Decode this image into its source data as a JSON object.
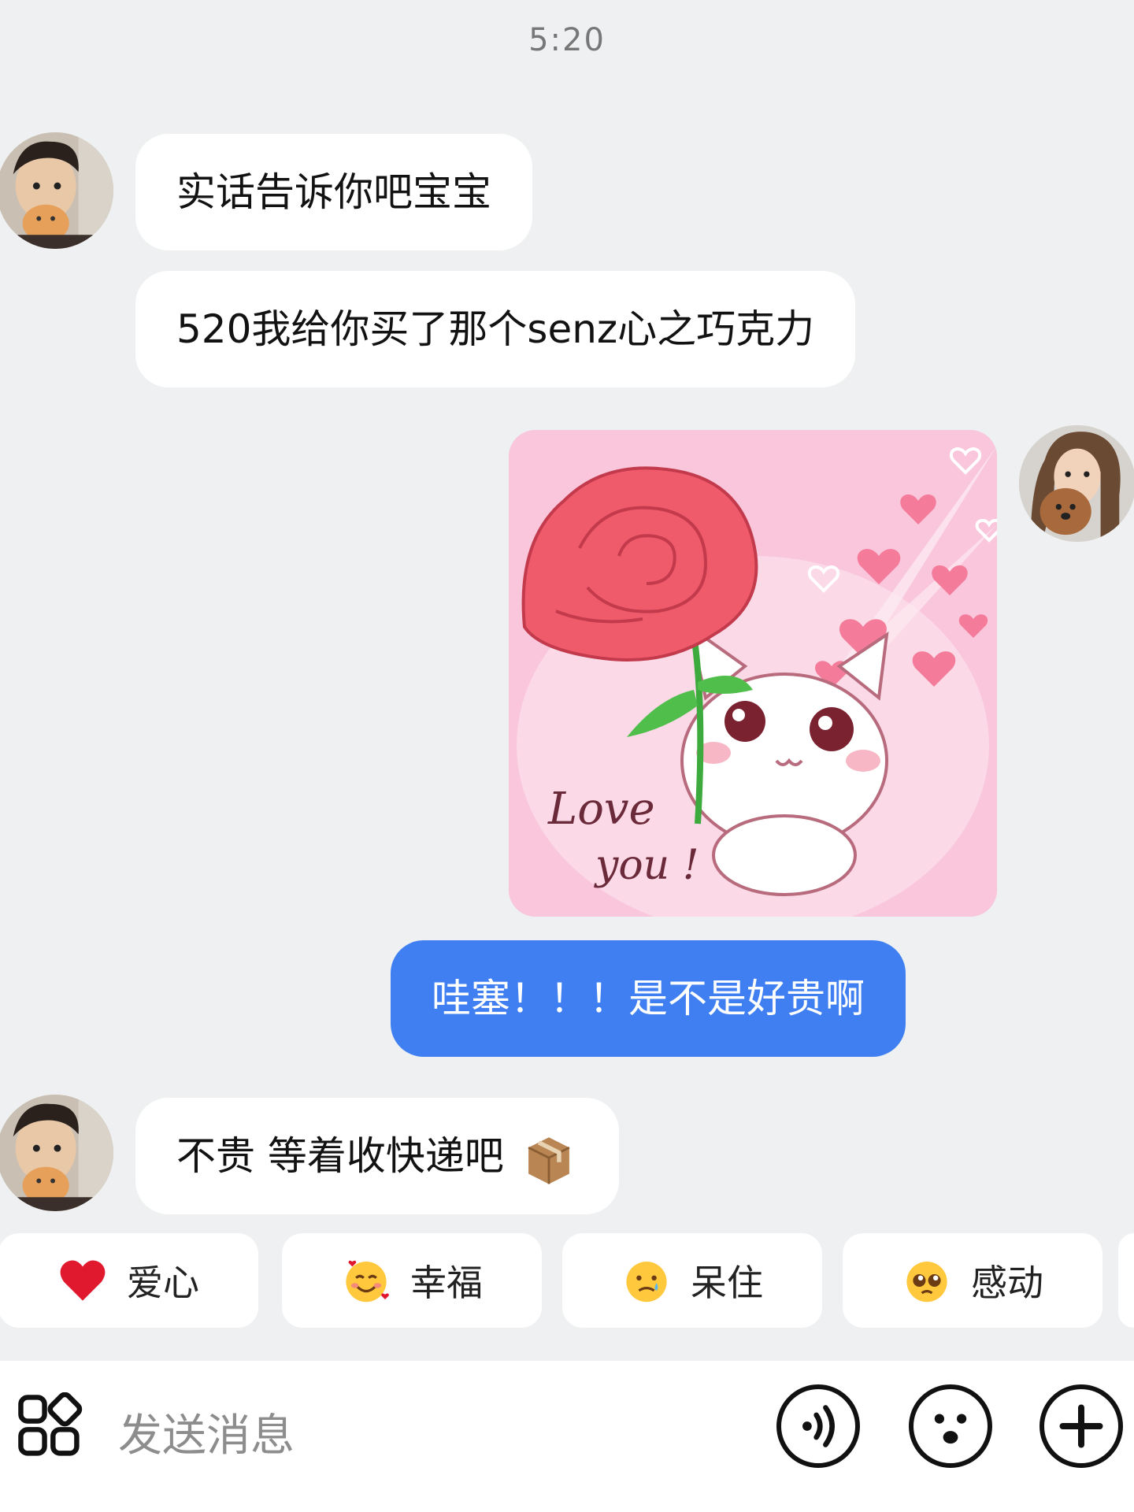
{
  "status": {
    "time": "5:20"
  },
  "messages": [
    {
      "from": "other",
      "text": "实话告诉你吧宝宝"
    },
    {
      "from": "other",
      "text": "520我给你买了那个senz心之巧克力"
    },
    {
      "from": "me",
      "type": "sticker",
      "sticker_text": [
        "Love",
        "you !"
      ]
    },
    {
      "from": "me",
      "text": "哇塞！！！是不是好贵啊"
    },
    {
      "from": "other",
      "text": "不贵 等着收快递吧"
    }
  ],
  "quick_reactions": [
    {
      "label": "爱心",
      "emoji": "❤️"
    },
    {
      "label": "幸福",
      "emoji": "🥰"
    },
    {
      "label": "呆住",
      "emoji": "🥲"
    },
    {
      "label": "感动",
      "emoji": "🥺"
    }
  ],
  "input": {
    "placeholder": "发送消息"
  },
  "icons": {
    "apps": "apps-grid-icon",
    "voice": "voice-icon",
    "emoji": "emoji-icon",
    "plus": "plus-icon",
    "package": "package-icon"
  },
  "colors": {
    "background": "#eef0f1",
    "my_bubble": "#3f7ff2",
    "other_bubble": "#ffffff",
    "sticker_bg": "#f9c6dc"
  }
}
